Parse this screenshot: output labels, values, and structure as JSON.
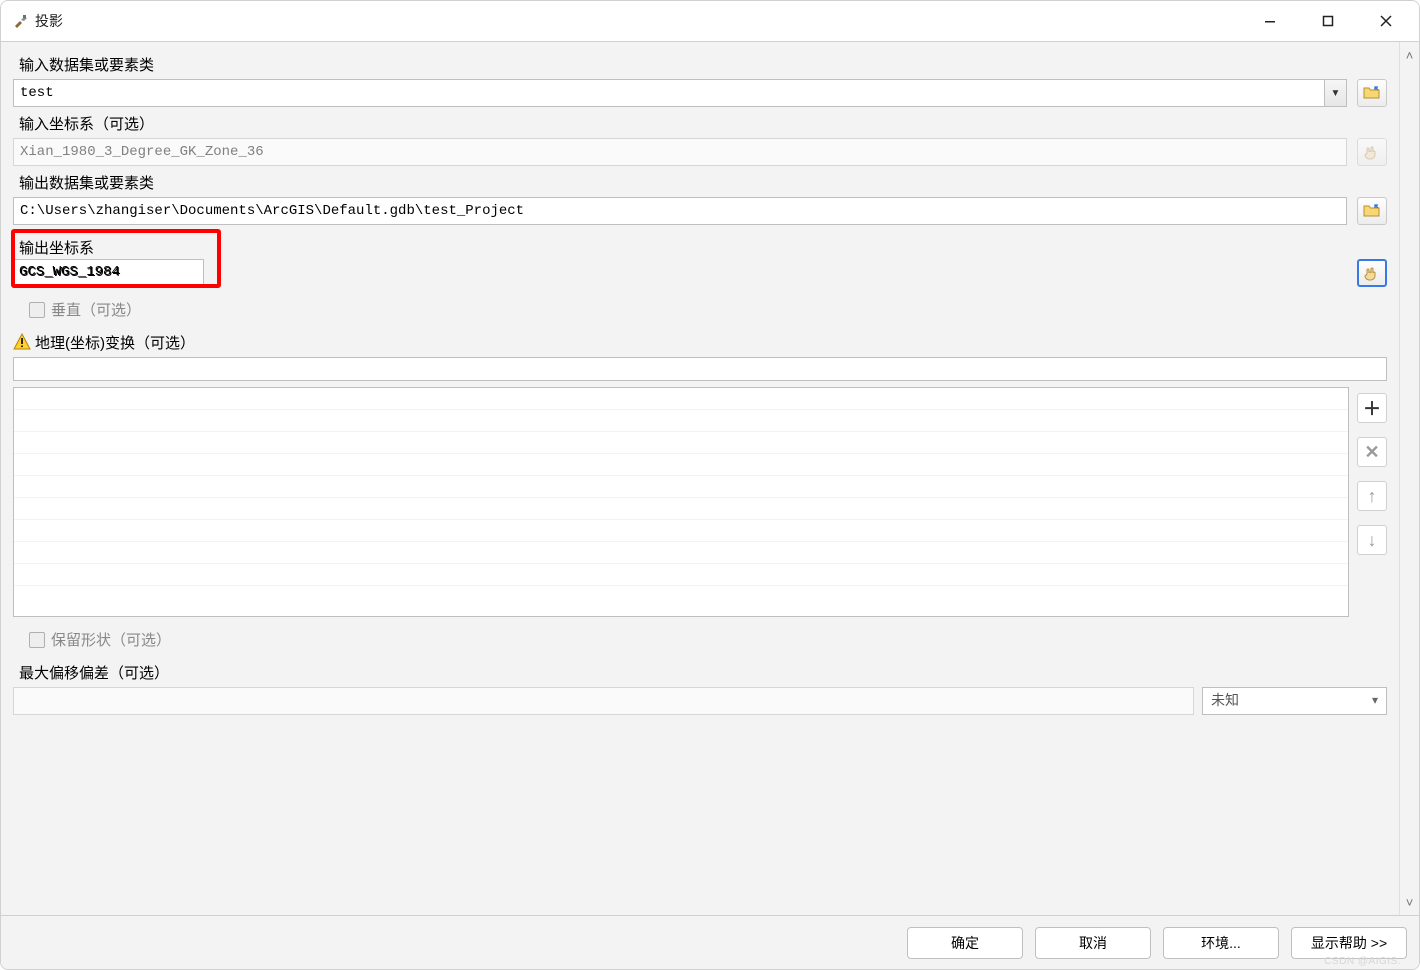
{
  "window": {
    "title": "投影"
  },
  "params": {
    "input_dataset": {
      "label": "输入数据集或要素类",
      "value": "test"
    },
    "input_cs": {
      "label": "输入坐标系（可选）",
      "value": "Xian_1980_3_Degree_GK_Zone_36"
    },
    "output_dataset": {
      "label": "输出数据集或要素类",
      "value": "C:\\Users\\zhangiser\\Documents\\ArcGIS\\Default.gdb\\test_Project"
    },
    "output_cs": {
      "label": "输出坐标系",
      "value": "GCS_WGS_1984"
    },
    "vertical": {
      "label": "垂直（可选）"
    },
    "geo_transform": {
      "label": "地理(坐标)变换（可选）"
    },
    "preserve_shape": {
      "label": "保留形状（可选）"
    },
    "max_offset": {
      "label": "最大偏移偏差（可选）",
      "unit": "未知"
    }
  },
  "buttons": {
    "ok": "确定",
    "cancel": "取消",
    "environments": "环境...",
    "show_help": "显示帮助 >>"
  },
  "watermark": "CSDN @AIGIS."
}
